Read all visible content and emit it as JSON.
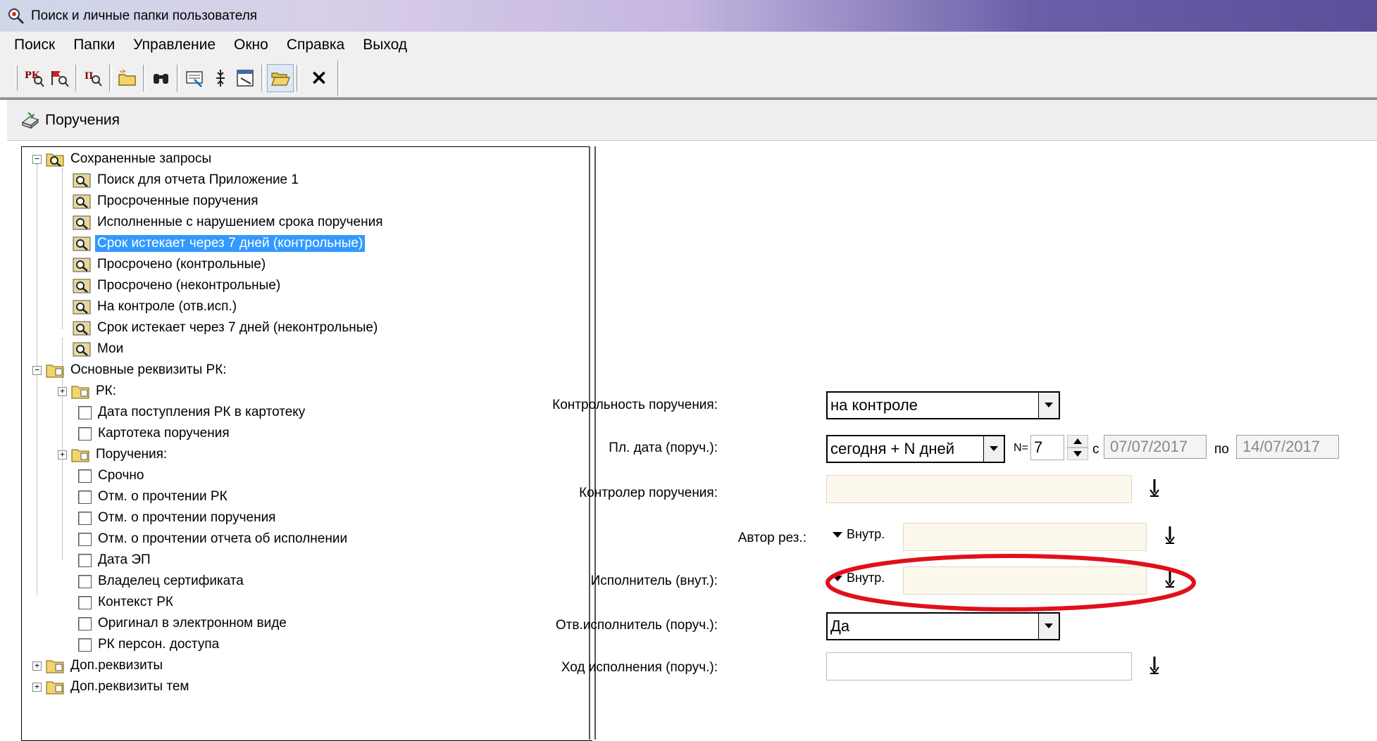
{
  "window": {
    "title": "Поиск и личные папки пользователя"
  },
  "menu": [
    "Поиск",
    "Папки",
    "Управление",
    "Окно",
    "Справка",
    "Выход"
  ],
  "toolbar": {
    "buttons": [
      "rk-icon",
      "search-flag-icon",
      "search-pt-icon",
      "new-folder-icon",
      "binoculars-icon",
      "filter-icon",
      "split-icon",
      "form-icon",
      "open-folder-icon"
    ],
    "close_label": "×"
  },
  "inner_window": {
    "title": "Поручения"
  },
  "tree": {
    "saved_queries": {
      "label": "Сохраненные запросы",
      "items": [
        "Поиск для отчета Приложение 1",
        "Просроченные поручения",
        "Исполненные с нарушением срока поручения",
        "Срок истекает через 7 дней (контрольные)",
        "Просрочено (контрольные)",
        "Просрочено (неконтрольные)",
        "На контроле (отв.исп.)",
        "Срок истекает через 7 дней (неконтрольные)",
        "Мои"
      ],
      "selected_index": 3
    },
    "main_props": {
      "label": "Основные реквизиты РК:",
      "rk_label": "РК:",
      "items_a": [
        "Дата поступления РК в картотеку",
        "Картотека поручения"
      ],
      "orders_label": "Поручения:",
      "items_b": [
        "Срочно",
        "Отм. о прочтении РК",
        "Отм. о прочтении поручения",
        "Отм. о прочтении отчета об исполнении",
        "Дата ЭП",
        "Владелец сертификата",
        "Контекст РК",
        "Оригинал в электронном виде",
        "РК персон. доступа"
      ]
    },
    "extra": [
      "Доп.реквизиты",
      "Доп.реквизиты тем"
    ]
  },
  "form": {
    "control": {
      "label": "Контрольность поручения:",
      "value": "на контроле"
    },
    "plan_date": {
      "label": "Пл. дата (поруч.):",
      "value": "сегодня + N дней",
      "n_label": "N=",
      "n_value": "7",
      "from_label": "с",
      "from_value": "07/07/2017",
      "to_label": "по",
      "to_value": "14/07/2017"
    },
    "controller": {
      "label": "Контролер поручения:"
    },
    "author": {
      "label": "Автор рез.:",
      "mode": "Внутр."
    },
    "executor": {
      "label": "Исполнитель (внут.):",
      "mode": "Внутр."
    },
    "resp_executor": {
      "label": "Отв.исполнитель (поруч.):",
      "value": "Да"
    },
    "progress": {
      "label": "Ход исполнения (поруч.):"
    },
    "highlight_color": "#e0101a"
  }
}
